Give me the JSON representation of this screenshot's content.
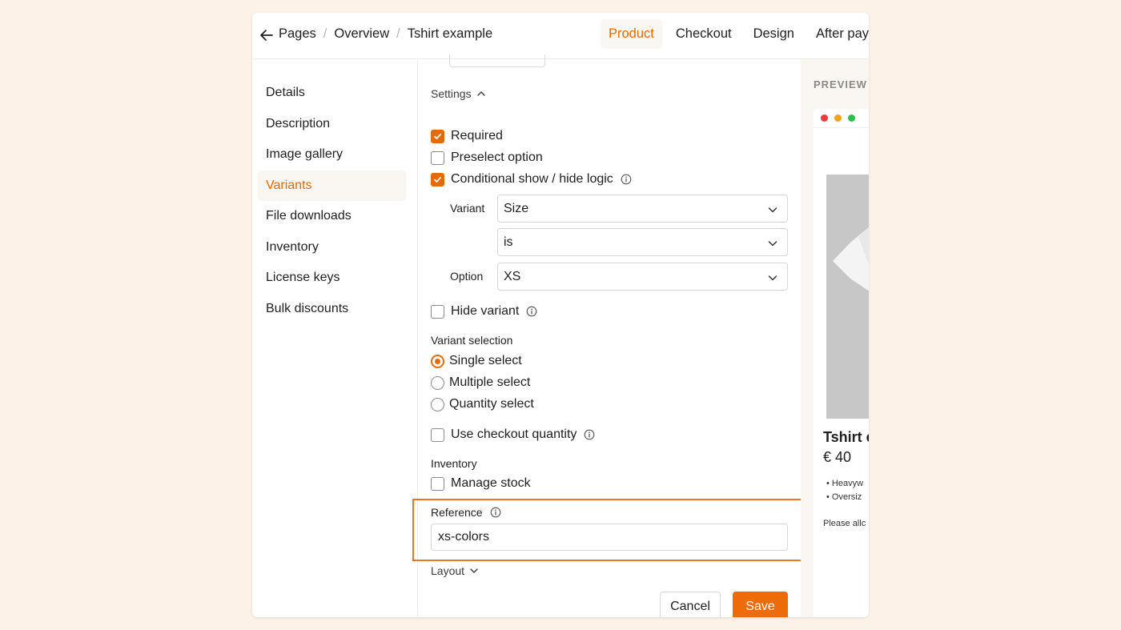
{
  "breadcrumbs": [
    "Pages",
    "Overview",
    "Tshirt example"
  ],
  "tabs": [
    {
      "label": "Product",
      "active": true
    },
    {
      "label": "Checkout",
      "active": false
    },
    {
      "label": "Design",
      "active": false
    },
    {
      "label": "After pay",
      "active": false
    }
  ],
  "sidebar": {
    "items": [
      {
        "label": "Details",
        "active": false
      },
      {
        "label": "Description",
        "active": false
      },
      {
        "label": "Image gallery",
        "active": false
      },
      {
        "label": "Variants",
        "active": true
      },
      {
        "label": "File downloads",
        "active": false
      },
      {
        "label": "Inventory",
        "active": false
      },
      {
        "label": "License keys",
        "active": false
      },
      {
        "label": "Bulk discounts",
        "active": false
      }
    ]
  },
  "settings": {
    "toggle_label": "Settings",
    "required": {
      "label": "Required",
      "checked": true
    },
    "preselect": {
      "label": "Preselect option",
      "checked": false
    },
    "conditional": {
      "label": "Conditional show / hide logic",
      "checked": true
    },
    "variant_label": "Variant",
    "variant_value": "Size",
    "operator_value": "is",
    "option_label": "Option",
    "option_value": "XS",
    "hide_variant": {
      "label": "Hide variant",
      "checked": false
    },
    "variant_selection_label": "Variant selection",
    "selection_options": [
      {
        "label": "Single select",
        "selected": true
      },
      {
        "label": "Multiple select",
        "selected": false
      },
      {
        "label": "Quantity select",
        "selected": false
      }
    ],
    "use_checkout_quantity": {
      "label": "Use checkout quantity",
      "checked": false
    },
    "inventory_label": "Inventory",
    "manage_stock": {
      "label": "Manage stock",
      "checked": false
    },
    "reference_label": "Reference",
    "reference_value": "xs-colors",
    "layout_label": "Layout"
  },
  "actions": {
    "cancel": "Cancel",
    "save": "Save"
  },
  "preview": {
    "label": "PREVIEW",
    "title": "Tshirt e",
    "price": "€ 40",
    "bullets": [
      "Heavyw",
      "Oversiz"
    ],
    "note": "Please allc"
  },
  "colors": {
    "accent": "#e56a06",
    "highlight": "#ee7322",
    "background": "#fdf2e8"
  }
}
